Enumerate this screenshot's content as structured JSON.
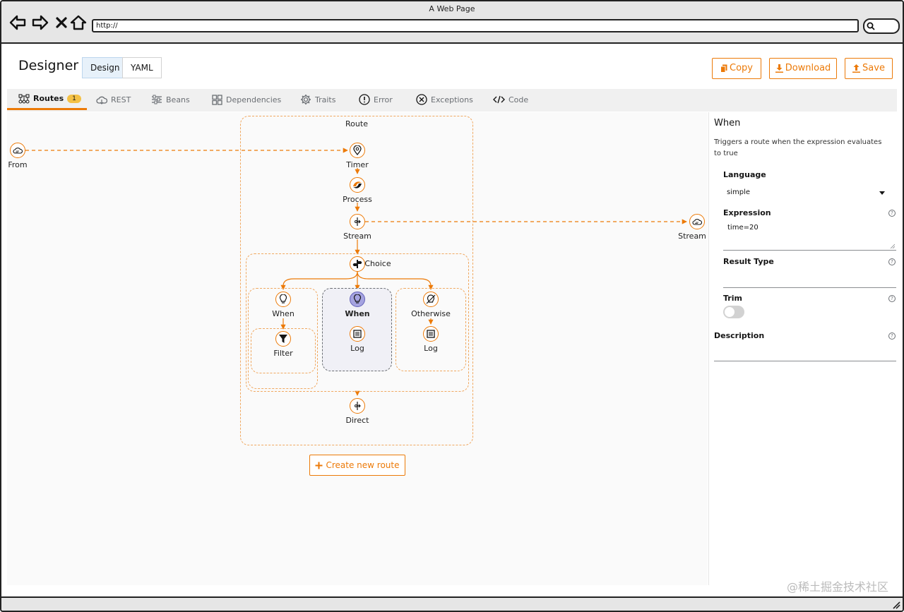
{
  "browser": {
    "window_title": "A Web Page",
    "url": "http://"
  },
  "app": {
    "title": "Designer",
    "view_modes": [
      "Design",
      "YAML"
    ],
    "actions": {
      "copy": "Copy",
      "download": "Download",
      "save": "Save"
    }
  },
  "tabs": [
    {
      "label": "Routes",
      "badge": "1",
      "icon": "routes-icon",
      "active": true
    },
    {
      "label": "REST",
      "icon": "cloud-icon"
    },
    {
      "label": "Beans",
      "icon": "sliders-icon"
    },
    {
      "label": "Dependencies",
      "icon": "blocks-icon"
    },
    {
      "label": "Traits",
      "icon": "gear-icon"
    },
    {
      "label": "Error",
      "icon": "exclamation-icon"
    },
    {
      "label": "Exceptions",
      "icon": "x-circle-icon"
    },
    {
      "label": "Code",
      "icon": "code-icon"
    }
  ],
  "canvas": {
    "route_label": "Route",
    "from_label": "From",
    "external_stream_label": "Stream",
    "steps": {
      "timer": "Timer",
      "process": "Process",
      "stream": "Stream",
      "choice": "Choice",
      "when1": "When",
      "filter": "Filter",
      "when2": "When",
      "log1": "Log",
      "otherwise": "Otherwise",
      "log2": "Log",
      "direct": "Direct"
    },
    "create_route": "Create new route"
  },
  "properties": {
    "title": "When",
    "description": "Triggers a route when the expression evaluates to true",
    "language_label": "Language",
    "language_value": "simple",
    "expression_label": "Expression",
    "expression_value": "time=20",
    "result_type_label": "Result Type",
    "trim_label": "Trim",
    "trim_on": false,
    "description_label": "Description"
  },
  "watermark": "@稀土掘金技术社区",
  "colors": {
    "accent": "#ec7a08",
    "selected": "#a5a3e0"
  }
}
